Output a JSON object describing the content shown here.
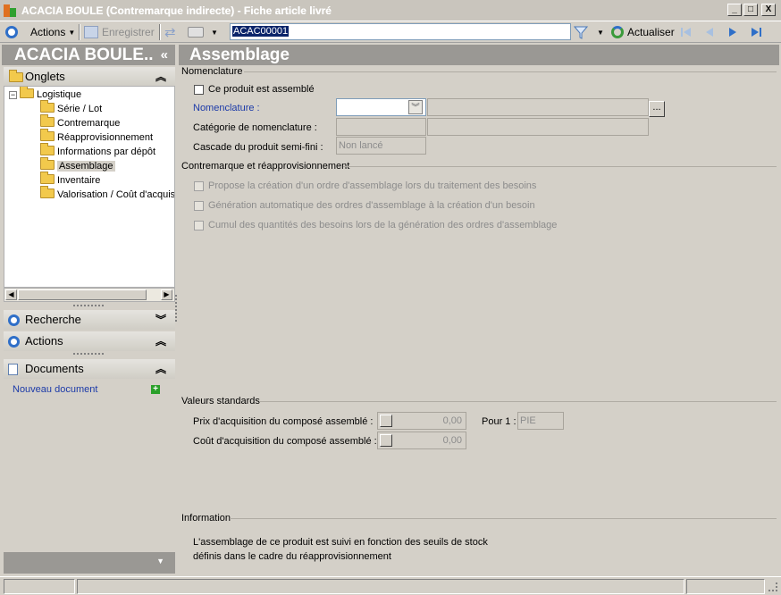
{
  "window": {
    "title": "ACACIA BOULE (Contremarque indirecte) - Fiche article livré",
    "min": "_",
    "max": "□",
    "close": "X"
  },
  "toolbar": {
    "actions_label": "Actions",
    "save_label": "Enregistrer",
    "search_value": "ACAC00001",
    "refresh_label": "Actualiser"
  },
  "left": {
    "header": "ACACIA BOULE..",
    "collapse": "«",
    "onglets_label": "Onglets",
    "tree": {
      "root": "Logistique",
      "items": [
        "Série / Lot",
        "Contremarque",
        "Réapprovisionnement",
        "Informations par dépôt",
        "Assemblage",
        "Inventaire",
        "Valorisation / Coût d'acquis"
      ],
      "selected": "Assemblage"
    },
    "recherche_label": "Recherche",
    "actions_label": "Actions",
    "documents_label": "Documents",
    "new_document": "Nouveau document"
  },
  "main": {
    "title": "Assemblage",
    "nomenclature": {
      "group": "Nomenclature",
      "assembled_label": "Ce produit est assemblé",
      "nomenclature_label": "Nomenclature :",
      "category_label": "Catégorie de nomenclature :",
      "cascade_label": "Cascade du produit semi-fini :",
      "cascade_value": "Non lancé",
      "ellipsis": "..."
    },
    "contremarque": {
      "group": "Contremarque et réapprovisionnement",
      "opt1": "Propose la création d'un ordre d'assemblage lors du traitement des besoins",
      "opt2": "Génération automatique des ordres d'assemblage à la création d'un besoin",
      "opt3": "Cumul des quantités des besoins lors de la génération des ordres d'assemblage"
    },
    "valeurs": {
      "group": "Valeurs standards",
      "prix_label": "Prix d'acquisition du composé assemblé :",
      "prix_value": "0,00",
      "cout_label": "Coût d'acquisition du composé assemblé :",
      "cout_value": "0,00",
      "pour_label": "Pour 1 :",
      "pour_value": "PIE"
    },
    "information": {
      "group": "Information",
      "line1": "L'assemblage de ce produit est suivi en fonction des seuils de stock",
      "line2": "définis dans le cadre du réapprovisionnement"
    }
  },
  "colors": {
    "header_bg": "#9a9894",
    "link": "#1c3aa8",
    "accent": "#2f6fc8"
  }
}
